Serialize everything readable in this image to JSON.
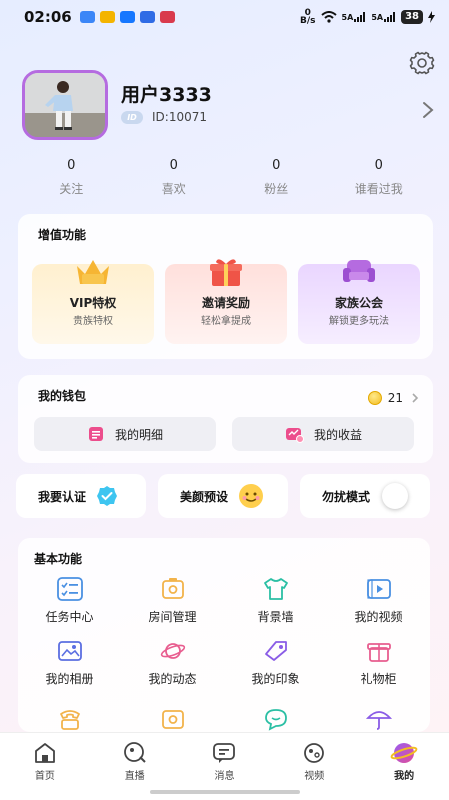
{
  "status_bar": {
    "time": "02:06",
    "net_speed_unit": "B/s",
    "net_speed_value": "0",
    "signal_1": "5A",
    "signal_2": "5A",
    "battery": "38",
    "app_icons": [
      "message-app-icon",
      "mail-app-icon",
      "alipay-icon",
      "finance-app-icon",
      "photo-app-icon"
    ]
  },
  "profile": {
    "username": "用户3333",
    "id_badge": "ID",
    "user_id": "ID:10071"
  },
  "stats": [
    {
      "value": "0",
      "label": "关注"
    },
    {
      "value": "0",
      "label": "喜欢"
    },
    {
      "value": "0",
      "label": "粉丝"
    },
    {
      "value": "0",
      "label": "谁看过我"
    }
  ],
  "value_added": {
    "title": "增值功能",
    "tiles": [
      {
        "title": "VIP特权",
        "subtitle": "贵族特权",
        "icon": "crown-icon",
        "bg": "#fff4dc"
      },
      {
        "title": "邀请奖励",
        "subtitle": "轻松拿提成",
        "icon": "gift-icon",
        "bg": "#ffe9e6"
      },
      {
        "title": "家族公会",
        "subtitle": "解锁更多玩法",
        "icon": "sofa-icon",
        "bg": "#f0e4ff"
      }
    ]
  },
  "wallet": {
    "title": "我的钱包",
    "coins": "21",
    "details_label": "我的明细",
    "earnings_label": "我的收益"
  },
  "quick_actions": [
    {
      "label": "我要认证",
      "icon": "verified-badge-icon"
    },
    {
      "label": "美颜预设",
      "icon": "smiley-face-icon"
    },
    {
      "label": "勿扰模式",
      "icon": "toggle-switch-icon"
    }
  ],
  "basic": {
    "title": "基本功能",
    "items": [
      {
        "label": "任务中心",
        "icon": "task-list-icon"
      },
      {
        "label": "房间管理",
        "icon": "room-icon"
      },
      {
        "label": "背景墙",
        "icon": "shirt-icon"
      },
      {
        "label": "我的视频",
        "icon": "video-icon"
      },
      {
        "label": "我的相册",
        "icon": "album-icon"
      },
      {
        "label": "我的动态",
        "icon": "planet-icon"
      },
      {
        "label": "我的印象",
        "icon": "tag-icon"
      },
      {
        "label": "礼物柜",
        "icon": "gift-box-icon"
      }
    ],
    "partial_icons": [
      "phone-icon",
      "room-icon",
      "chat-bubble-icon",
      "umbrella-icon"
    ]
  },
  "bottom_nav": [
    {
      "label": "首页",
      "icon": "home-icon"
    },
    {
      "label": "直播",
      "icon": "live-icon"
    },
    {
      "label": "消息",
      "icon": "message-icon"
    },
    {
      "label": "视频",
      "icon": "video-tab-icon"
    },
    {
      "label": "我的",
      "icon": "profile-planet-icon",
      "active": true
    }
  ],
  "colors": {
    "accent_purple": "#b56be0",
    "accent_pink": "#ec4d8c",
    "coin_gold": "#f3bd23"
  }
}
